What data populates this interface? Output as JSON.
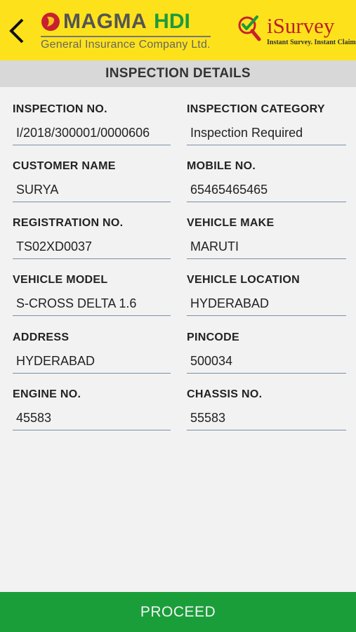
{
  "header": {
    "brand_name": "MAGMA",
    "brand_name_2": "HDI",
    "brand_subtitle": "General Insurance Company Ltd.",
    "app_name": "iSurvey",
    "app_tagline": "Instant Survey. Instant Claim.",
    "back_icon": "chevron-left-icon",
    "colors": {
      "header_bg": "#fde21b",
      "brand_green": "#1c9a3d",
      "app_red": "#bc1f27"
    }
  },
  "page": {
    "title": "INSPECTION DETAILS"
  },
  "fields": {
    "inspection_no": {
      "label": "INSPECTION NO.",
      "value": "I/2018/300001/0000606"
    },
    "inspection_category": {
      "label": "INSPECTION CATEGORY",
      "value": "Inspection Required"
    },
    "customer_name": {
      "label": "CUSTOMER NAME",
      "value": "SURYA"
    },
    "mobile_no": {
      "label": "MOBILE NO.",
      "value": "65465465465"
    },
    "registration_no": {
      "label": "REGISTRATION NO.",
      "value": "TS02XD0037"
    },
    "vehicle_make": {
      "label": "VEHICLE MAKE",
      "value": "MARUTI"
    },
    "vehicle_model": {
      "label": "VEHICLE MODEL",
      "value": "S-CROSS DELTA 1.6"
    },
    "vehicle_location": {
      "label": "VEHICLE LOCATION",
      "value": "HYDERABAD"
    },
    "address": {
      "label": "ADDRESS",
      "value": "HYDERABAD"
    },
    "pincode": {
      "label": "PINCODE",
      "value": "500034"
    },
    "engine_no": {
      "label": "ENGINE NO.",
      "value": "45583"
    },
    "chassis_no": {
      "label": "CHASSIS NO.",
      "value": "55583"
    }
  },
  "footer": {
    "proceed_label": "PROCEED",
    "color": "#1a9e3a"
  }
}
